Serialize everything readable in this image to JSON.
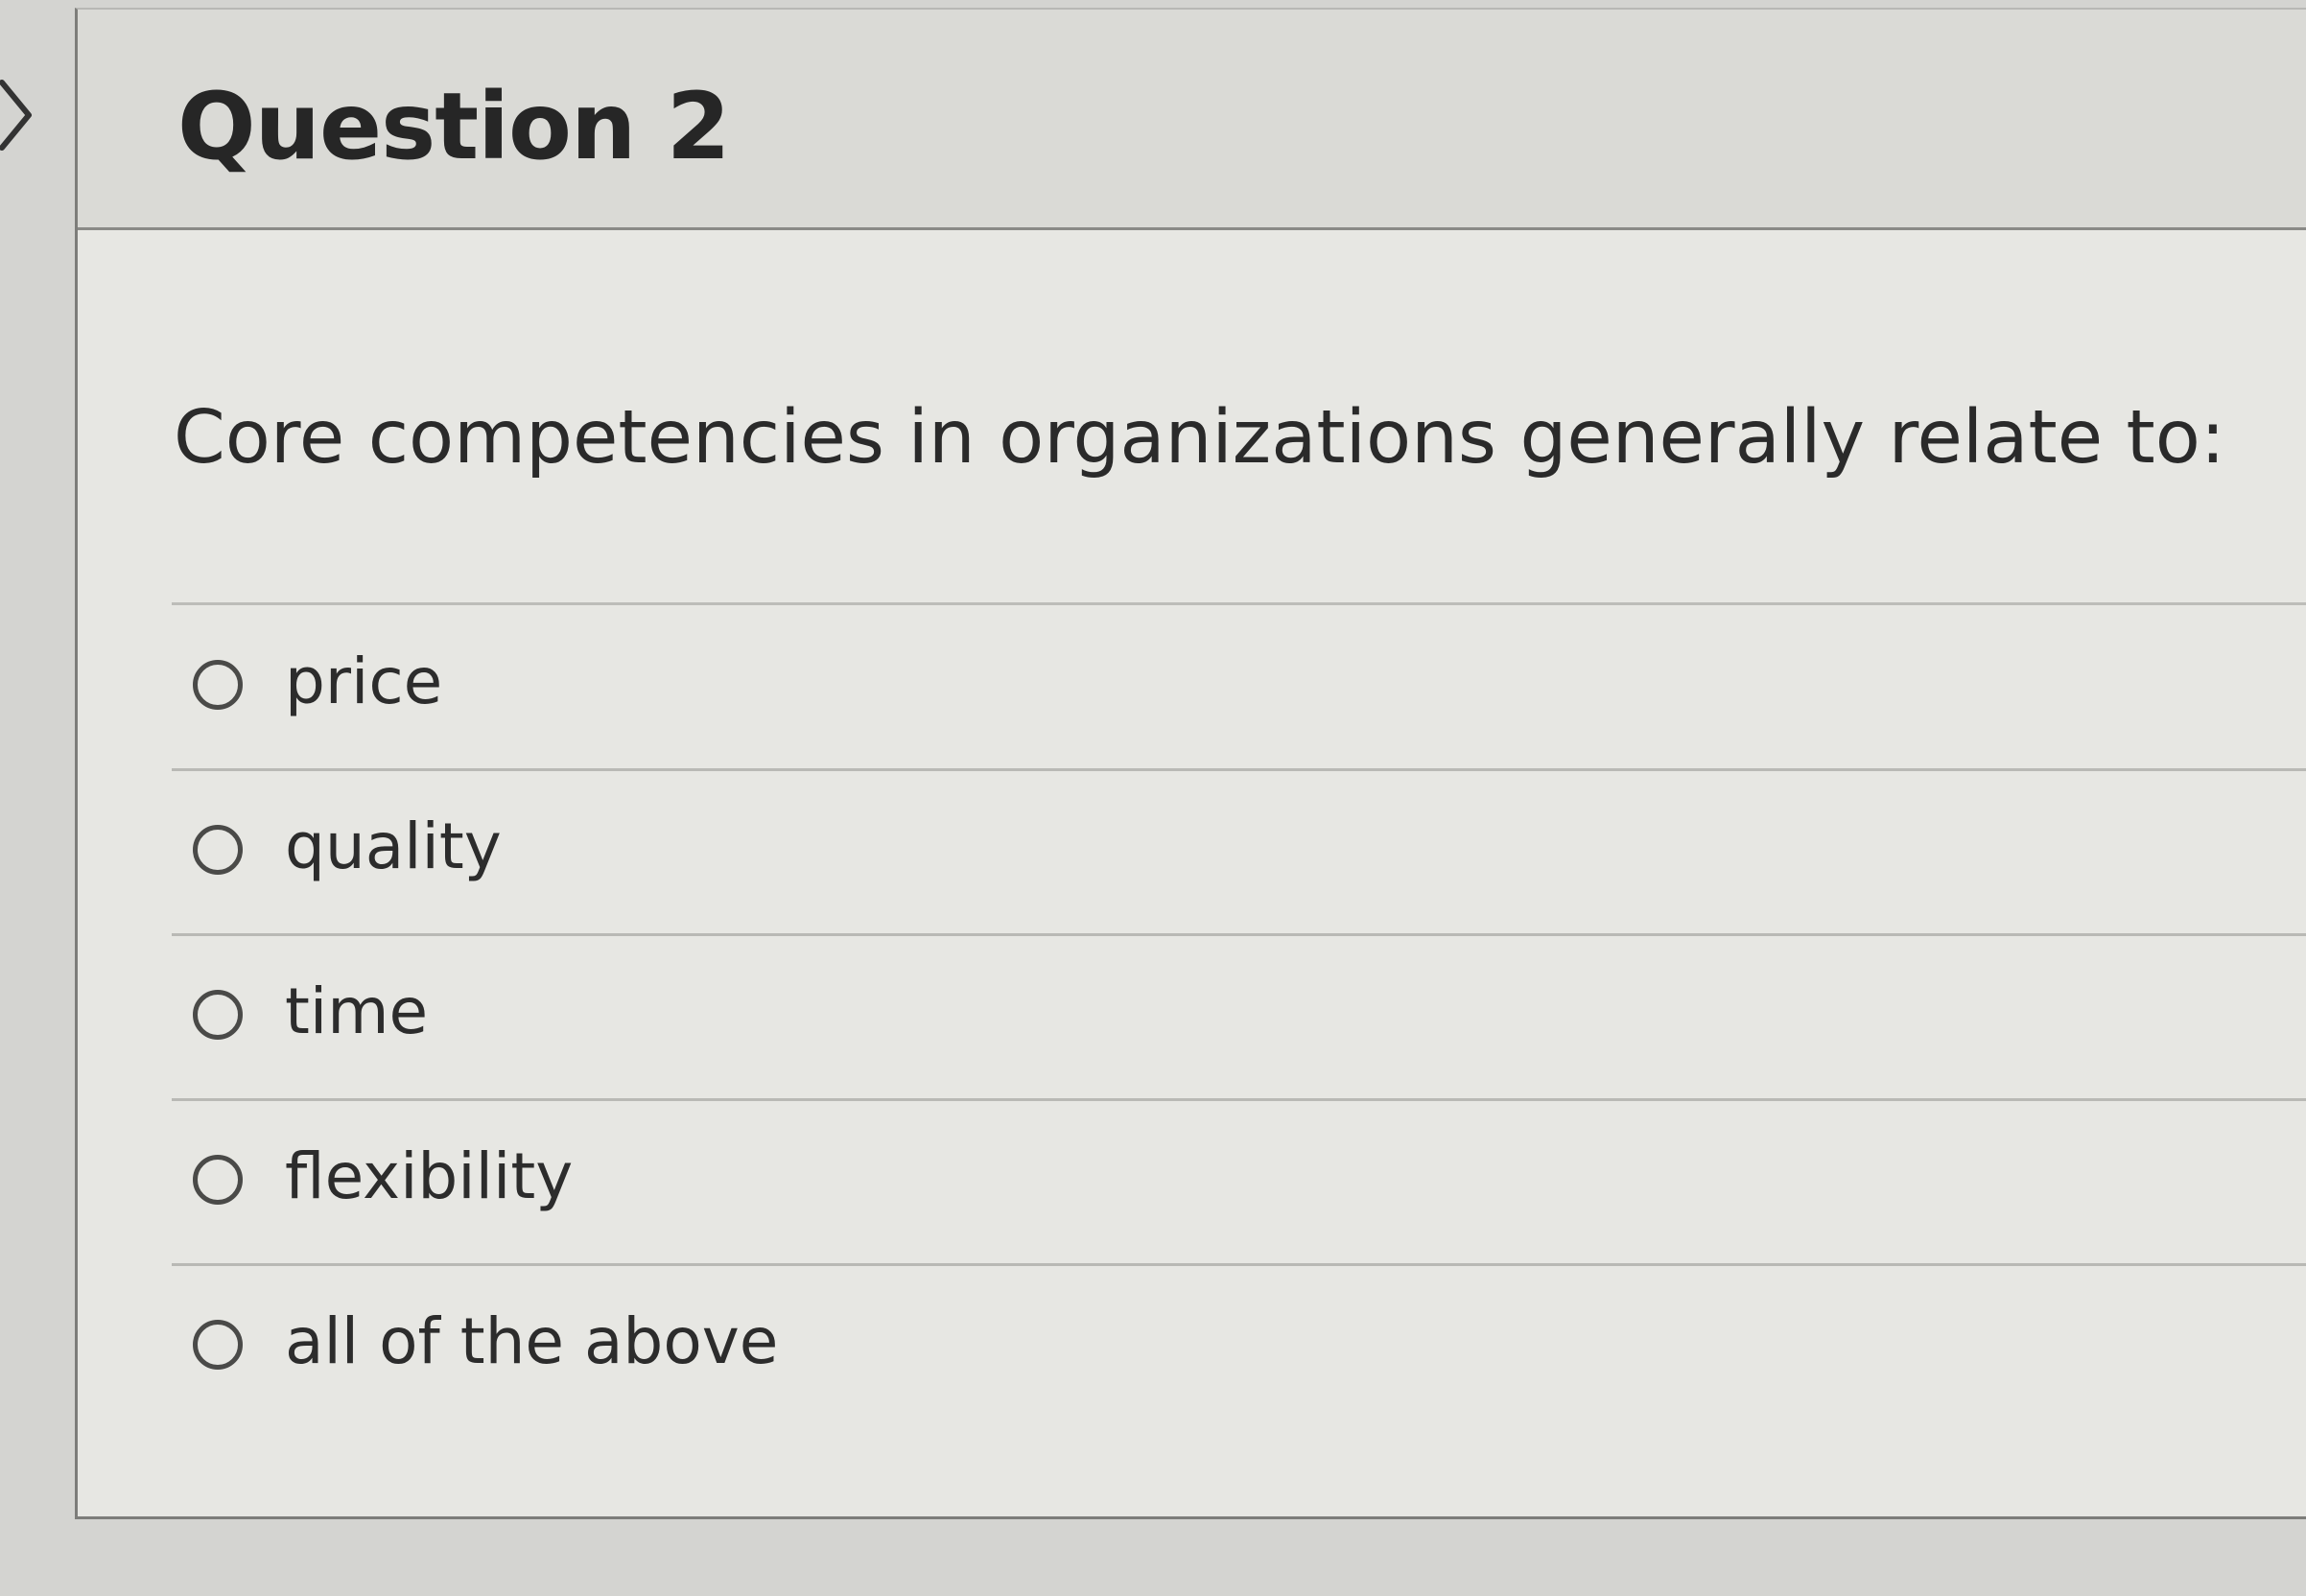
{
  "question": {
    "title": "Question 2",
    "text": "Core competencies in organizations generally relate to:",
    "answers": [
      {
        "label": "price",
        "selected": false
      },
      {
        "label": "quality",
        "selected": false
      },
      {
        "label": "time",
        "selected": false
      },
      {
        "label": "flexibility",
        "selected": false
      },
      {
        "label": "all of the above",
        "selected": false
      }
    ]
  },
  "icons": {
    "collapse": "chevron-right-icon",
    "radio": "radio-unchecked-icon"
  },
  "colors": {
    "background": "#d4d4d1",
    "card": "#e7e7e3",
    "header": "#dadad6",
    "text": "#2b2b2b"
  }
}
